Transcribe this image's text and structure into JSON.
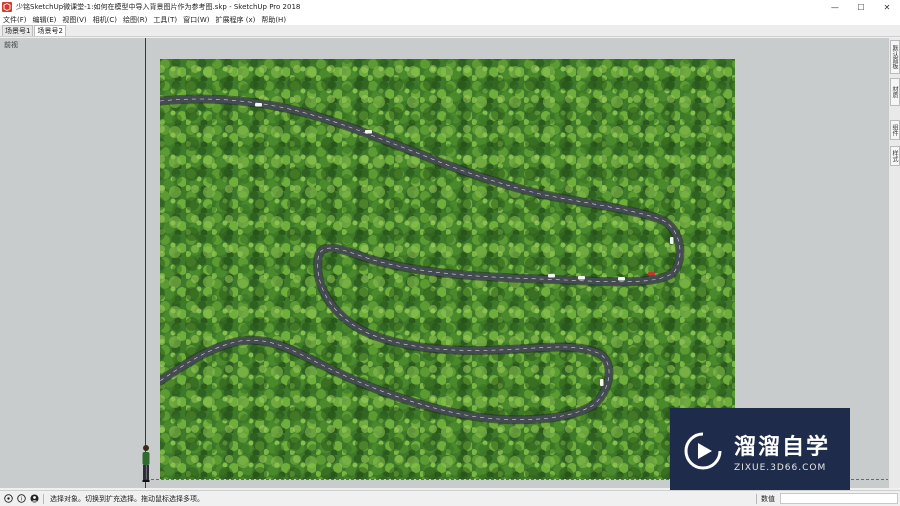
{
  "window": {
    "title": "少铭SketchUp微课堂-1:如何在模型中导入背景图片作为参考图.skp - SketchUp Pro 2018",
    "minimize": "—",
    "maximize": "☐",
    "close": "✕"
  },
  "menu": {
    "items": [
      {
        "label": "文件(F)"
      },
      {
        "label": "编辑(E)"
      },
      {
        "label": "视图(V)"
      },
      {
        "label": "相机(C)"
      },
      {
        "label": "绘图(R)"
      },
      {
        "label": "工具(T)"
      },
      {
        "label": "窗口(W)"
      },
      {
        "label": "扩展程序 (x)"
      },
      {
        "label": "帮助(H)"
      }
    ]
  },
  "scenes": {
    "tabs": [
      {
        "label": "场景号1"
      },
      {
        "label": "场景号2"
      }
    ]
  },
  "viewport": {
    "label": "前视"
  },
  "tray": {
    "tabs": [
      {
        "label": "默认面板"
      },
      {
        "label": "材质"
      },
      {
        "label": "组件"
      },
      {
        "label": "样式"
      }
    ]
  },
  "watermark": {
    "brand": "溜溜自学",
    "url": "ZIXUE.3D66.COM"
  },
  "status": {
    "hint": "选择对象。切换到扩充选择。拖动鼠标选择多项。",
    "measurement_label": "数值",
    "measurement_value": ""
  },
  "colors": {
    "viewport_bg": "#c8cccd",
    "axis_blue": "#2a2aa8",
    "axis_red": "#dd3344",
    "watermark_bg": "#1e2b4a"
  }
}
